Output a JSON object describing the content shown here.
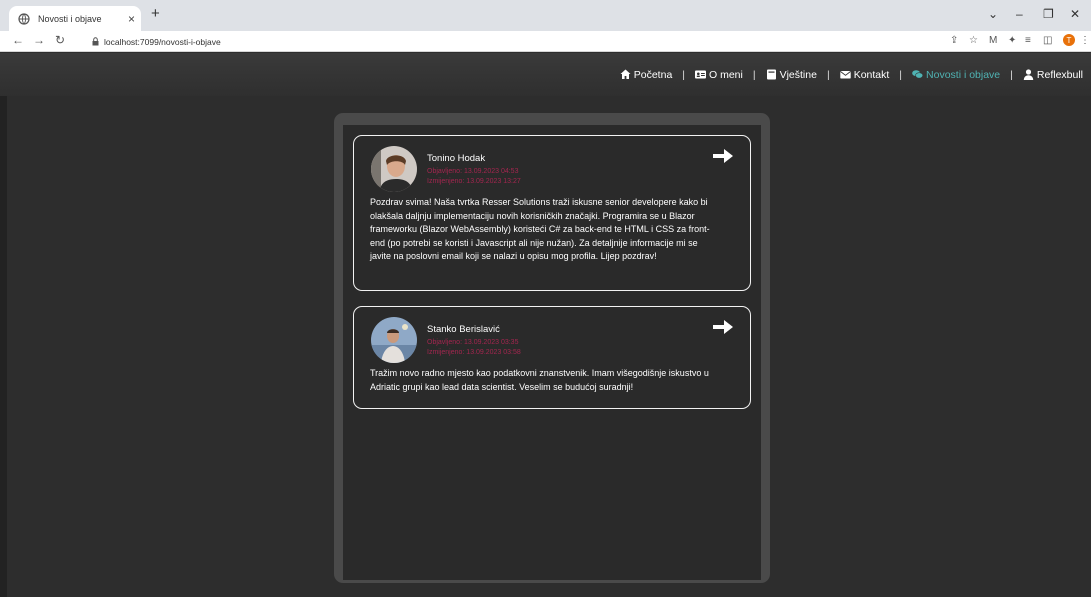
{
  "browser": {
    "tab_title": "Novosti i objave",
    "url": "localhost:7099/novosti-i-objave",
    "profile_initial": "T"
  },
  "nav": {
    "items": [
      {
        "label": "Početna",
        "icon": "home-icon"
      },
      {
        "label": "O meni",
        "icon": "id-card-icon"
      },
      {
        "label": "Vještine",
        "icon": "book-icon"
      },
      {
        "label": "Kontakt",
        "icon": "envelope-icon"
      },
      {
        "label": "Novosti i objave",
        "icon": "comments-icon",
        "active": true
      },
      {
        "label": "Reflexbull",
        "icon": "user-icon"
      }
    ],
    "separator": "|",
    "active_color": "#4fb3b3"
  },
  "posts": [
    {
      "author": "Tonino Hodak",
      "published": "Objavljeno: 13.09.2023 04:53",
      "edited": "Izmijenjeno: 13.09.2023 13:27",
      "body": "Pozdrav svima! Naša tvrtka Resser Solutions traži iskusne senior developere kako bi olakšala daljnju implementaciju novih korisničkih značajki. Programira se u Blazor frameworku (Blazor WebAssembly) koristeći C# za back-end te HTML i CSS za front-end (po potrebi se koristi i Javascript ali nije nužan). Za detaljnije informacije mi se javite na poslovni email koji se nalazi u opisu mog profila. Lijep pozdrav!"
    },
    {
      "author": "Stanko Berislavić",
      "published": "Objavljeno: 13.09.2023 03:35",
      "edited": "Izmijenjeno: 13.09.2023 03:58",
      "body": "Tražim novo radno mjesto kao podatkovni znanstvenik. Imam višegodišnje iskustvo u Adriatic grupi kao lead data scientist. Veselim se budućoj suradnji!"
    }
  ],
  "colors": {
    "meta": "#a3264f",
    "page_bg": "#2d2d2d",
    "card_border": "#f2f2f2"
  }
}
